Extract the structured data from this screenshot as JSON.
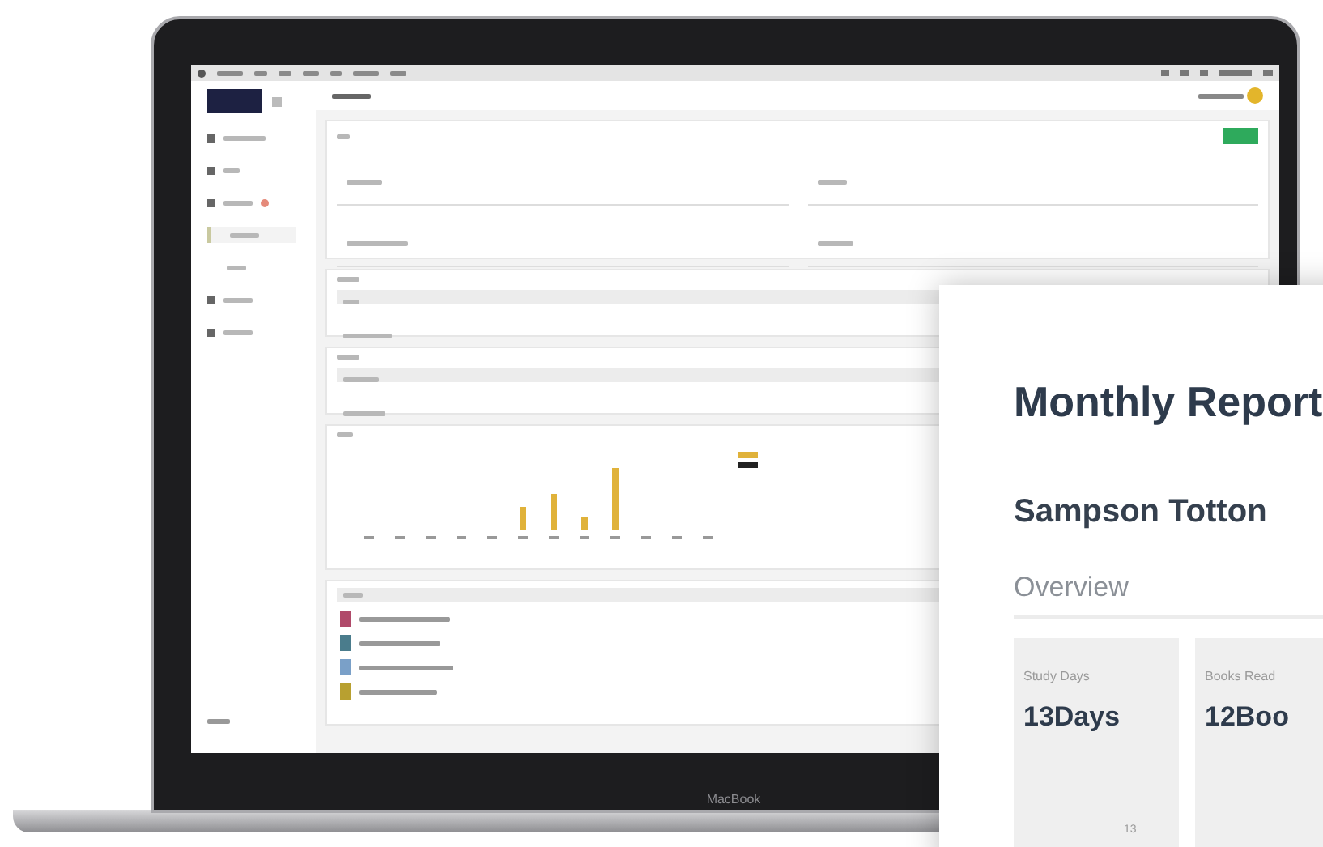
{
  "laptop": {
    "brand_label": "MacBook"
  },
  "sidebar": {
    "items": [
      {
        "selected": false
      },
      {
        "selected": false
      },
      {
        "selected": false
      },
      {
        "selected": true
      },
      {
        "selected": false
      },
      {
        "selected": false
      },
      {
        "selected": false
      }
    ]
  },
  "report": {
    "title": "Monthly Report",
    "student": "Sampson Totton",
    "section": "Overview",
    "stats": [
      {
        "label": "Study Days",
        "value": "13Days"
      },
      {
        "label": "Books Read",
        "value": "12Boo"
      }
    ],
    "chart_tick": "13"
  }
}
